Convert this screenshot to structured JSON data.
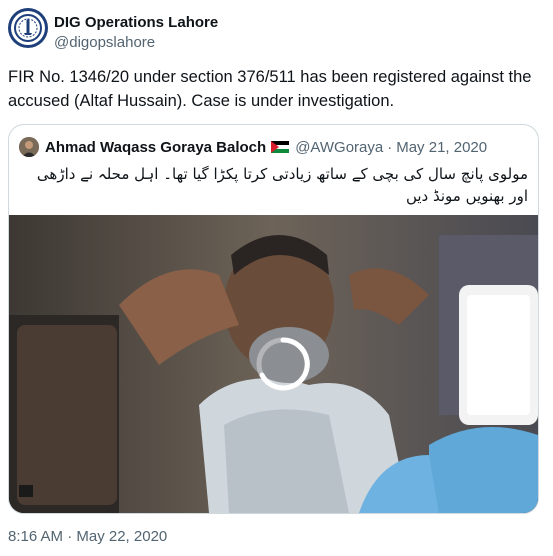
{
  "tweet": {
    "display_name": "DIG Operations Lahore",
    "handle": "@digopslahore",
    "text": "FIR No. 1346/20 under section 376/511 has been registered against the accused (Altaf Hussain). Case is under investigation.",
    "timestamp": "8:16 AM · May 22, 2020"
  },
  "quoted_tweet": {
    "display_name": "Ahmad Waqass Goraya Baloch",
    "flag_icon": "palestine-flag-icon",
    "handle": "@AWGoraya",
    "separator": "·",
    "date": "May 21, 2020",
    "text": "مولوی پانچ سال کی بچی کے ساتھ زیادتی کرتا پکڑا گیا تھا۔ اہل محلہ نے داڑھی اور بھنویں مونڈ دیں"
  },
  "media": {
    "type": "video",
    "state": "loading",
    "icon": "loading-spinner-icon"
  },
  "colors": {
    "text": "#0f1419",
    "secondary": "#536471",
    "border": "#cfd9de",
    "avatar_bg": "#1e3f7a"
  }
}
